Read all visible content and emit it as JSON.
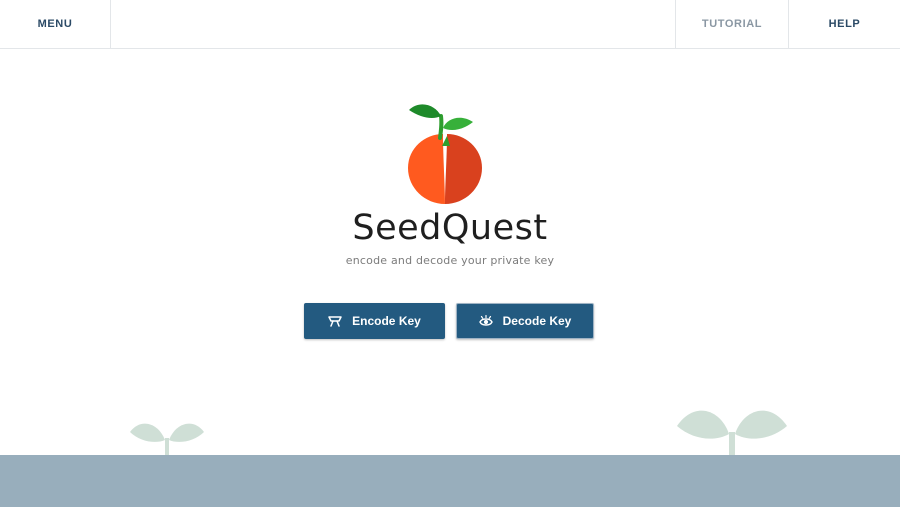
{
  "nav": {
    "menu_label": "MENU",
    "tutorial_label": "TUTORIAL",
    "help_label": "HELP"
  },
  "hero": {
    "title": "SeedQuest",
    "subtitle": "encode and decode your private key",
    "logo_icon": "sprouting-seed-logo"
  },
  "actions": {
    "encode_label": "Encode Key",
    "encode_icon": "encode-icon",
    "decode_label": "Decode Key",
    "decode_icon": "eye-icon"
  },
  "colors": {
    "primary_button": "#235a80",
    "nav_text": "#2b4a66",
    "nav_text_muted": "#8a97a3",
    "ground": "#98aebc",
    "sprout": "#cfdfd6",
    "seed_left": "#ff5a1f",
    "seed_right": "#d9411e",
    "leaf": "#2f9e2f"
  }
}
